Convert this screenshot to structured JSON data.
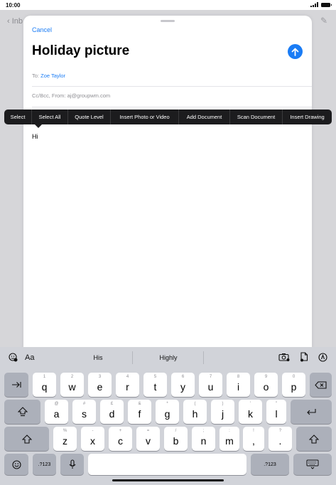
{
  "status_bar": {
    "time": "10:00"
  },
  "background": {
    "back_label": "Inb"
  },
  "compose": {
    "cancel_label": "Cancel",
    "subject": "Holiday picture",
    "to_label": "To:",
    "to_value": "Zoe Taylor",
    "cc_label": "Cc/Bcc, From:",
    "cc_value": "aj@groupwm.com",
    "body": "Hi"
  },
  "edit_menu": {
    "items": [
      "Select",
      "Select All",
      "Quote Level",
      "Insert Photo or Video",
      "Add Document",
      "Scan Document",
      "Insert Drawing"
    ]
  },
  "keyboard": {
    "aa_label": "Aa",
    "suggestions": [
      "His",
      "Highly"
    ],
    "row1": [
      {
        "sub": "1",
        "main": "q"
      },
      {
        "sub": "2",
        "main": "w"
      },
      {
        "sub": "3",
        "main": "e"
      },
      {
        "sub": "4",
        "main": "r"
      },
      {
        "sub": "5",
        "main": "t"
      },
      {
        "sub": "6",
        "main": "y"
      },
      {
        "sub": "7",
        "main": "u"
      },
      {
        "sub": "8",
        "main": "i"
      },
      {
        "sub": "9",
        "main": "o"
      },
      {
        "sub": "0",
        "main": "p"
      }
    ],
    "row2": [
      {
        "sub": "@",
        "main": "a"
      },
      {
        "sub": "#",
        "main": "s"
      },
      {
        "sub": "£",
        "main": "d"
      },
      {
        "sub": "&",
        "main": "f"
      },
      {
        "sub": "*",
        "main": "g"
      },
      {
        "sub": "(",
        "main": "h"
      },
      {
        "sub": ")",
        "main": "j"
      },
      {
        "sub": "'",
        "main": "k"
      },
      {
        "sub": "\"",
        "main": "l"
      }
    ],
    "row3": [
      {
        "sub": "%",
        "main": "z"
      },
      {
        "sub": "-",
        "main": "x"
      },
      {
        "sub": "+",
        "main": "c"
      },
      {
        "sub": "=",
        "main": "v"
      },
      {
        "sub": "/",
        "main": "b"
      },
      {
        "sub": ";",
        "main": "n"
      },
      {
        "sub": ":",
        "main": "m"
      },
      {
        "sub": "!",
        "main": ","
      },
      {
        "sub": "?",
        "main": "."
      }
    ],
    "numbers_label": ".?123"
  },
  "colors": {
    "accent": "#1a7cf5",
    "menu_bg": "#1c1c1e",
    "keyboard_bg": "#d1d3d9"
  }
}
